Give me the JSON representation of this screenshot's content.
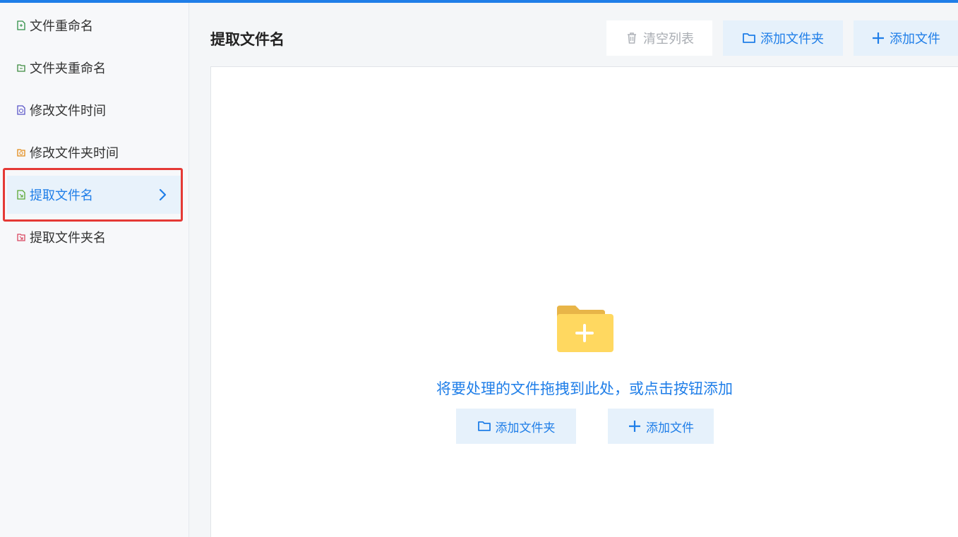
{
  "sidebar": {
    "items": [
      {
        "label": "文件重命名",
        "icon": "file-rename-icon",
        "color": "#2f8f46"
      },
      {
        "label": "文件夹重命名",
        "icon": "folder-rename-icon",
        "color": "#3c8a3f"
      },
      {
        "label": "修改文件时间",
        "icon": "file-time-icon",
        "color": "#5a54c8"
      },
      {
        "label": "修改文件夹时间",
        "icon": "folder-time-icon",
        "color": "#e38a17"
      },
      {
        "label": "提取文件名",
        "icon": "extract-filename-icon",
        "color": "#5aa832",
        "active": true
      },
      {
        "label": "提取文件夹名",
        "icon": "extract-foldername-icon",
        "color": "#d9455f"
      }
    ]
  },
  "main": {
    "title": "提取文件名",
    "toolbar": {
      "clear_label": "清空列表",
      "add_folder_label": "添加文件夹",
      "add_file_label": "添加文件"
    },
    "drop_area": {
      "hint": "将要处理的文件拖拽到此处，或点击按钮添加",
      "add_folder_label": "添加文件夹",
      "add_file_label": "添加文件"
    }
  },
  "colors": {
    "accent": "#1f7ee8",
    "highlight": "#e53935",
    "folder": "#ffd860"
  }
}
